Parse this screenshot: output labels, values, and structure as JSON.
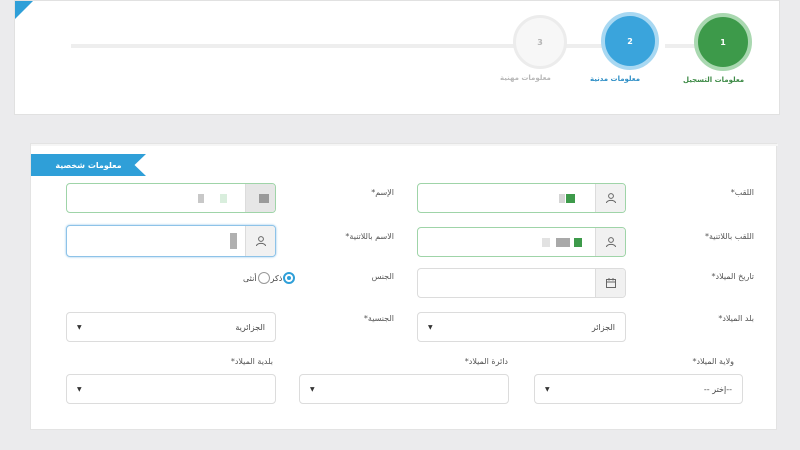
{
  "stepper": {
    "steps": [
      {
        "num": "1",
        "label": "معلومات التسجيل"
      },
      {
        "num": "2",
        "label": "معلومات مدنية"
      },
      {
        "num": "3",
        "label": "معلومات مهنية"
      }
    ]
  },
  "form": {
    "section_title": "معلومات شخصية",
    "labels": {
      "surname": "اللقب*",
      "name": "الإسم*",
      "surname_latin": "اللقب باللاتنية*",
      "name_latin": "الاسم باللاتنية*",
      "birth_date": "تاريخ الميلاد*",
      "gender": "الجنس",
      "birth_country": "بلد الميلاد*",
      "nationality": "الجنسية*",
      "birth_province": "ولاية الميلاد*",
      "birth_district": "دائرة الميلاد*",
      "birth_municipality": "بلدية الميلاد*"
    },
    "gender_options": {
      "male": "ذكر",
      "female": "أنثى",
      "selected": "male"
    },
    "selects": {
      "birth_country": "الجزائر",
      "nationality": "الجزائرية",
      "birth_province": "--إختر --",
      "birth_district": "",
      "birth_municipality": ""
    }
  },
  "icons": {
    "user": "user-icon",
    "calendar": "calendar-icon",
    "caret": "caret-down-icon"
  },
  "colors": {
    "accent": "#2f9fd8",
    "step_done": "#3d9a4a",
    "step_active": "#3aa4dc"
  }
}
